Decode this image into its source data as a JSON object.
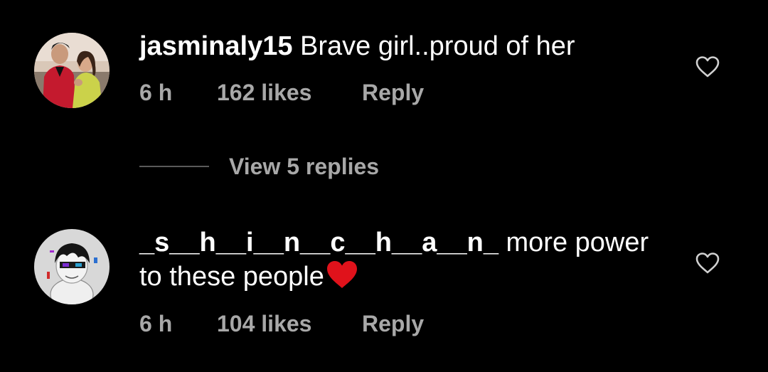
{
  "comments": [
    {
      "username": "jasminaly15",
      "text": "Brave girl..proud of her",
      "time": "6 h",
      "likes": "162 likes",
      "reply_label": "Reply",
      "view_replies": "View 5 replies",
      "like_icon": "heart-outline-icon"
    },
    {
      "username": "_s__h__i__n__c__h__a__n_",
      "text": "more power",
      "text_line2": "to these people",
      "emoji": "red-heart-emoji",
      "time": "6 h",
      "likes": "104 likes",
      "reply_label": "Reply",
      "like_icon": "heart-outline-icon"
    }
  ],
  "colors": {
    "background": "#000000",
    "primary_text": "#ffffff",
    "secondary_text": "#a8a8a8",
    "emoji_heart": "#e0121b"
  }
}
